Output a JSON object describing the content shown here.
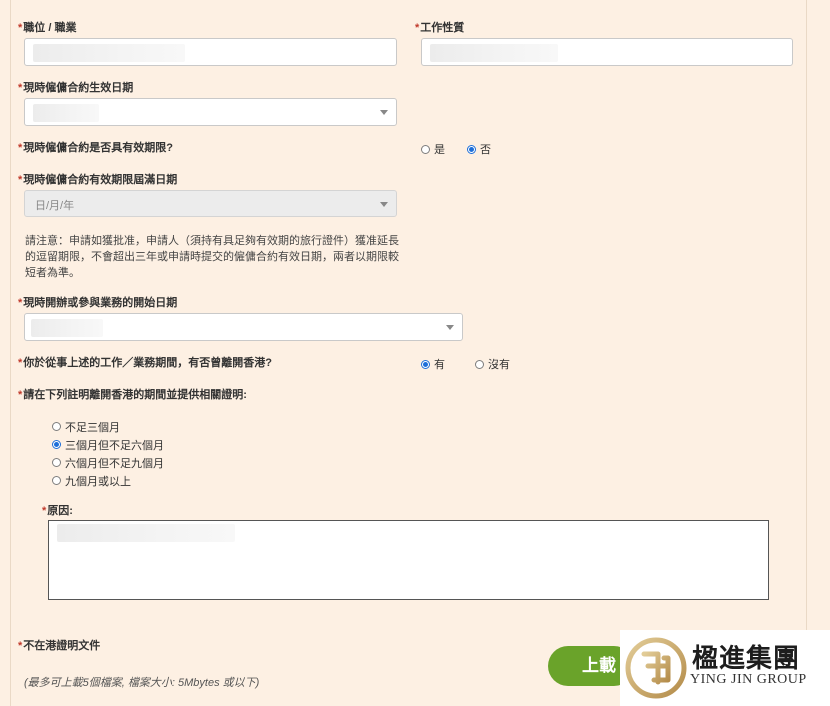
{
  "required_mark": "*",
  "occupation": {
    "label": "職位 / 職業"
  },
  "job_nature": {
    "label": "工作性質"
  },
  "contract_effective_date": {
    "label": "現時僱傭合約生效日期"
  },
  "contract_has_validity": {
    "label": "現時僱傭合約是否具有效期限?",
    "options": [
      "是",
      "否"
    ],
    "selected": "否"
  },
  "contract_expiry_date": {
    "label": "現時僱傭合約有效期限屆滿日期",
    "placeholder": "日/月/年",
    "disabled": true
  },
  "notice_text": "請注意：申請如獲批准，申請人（須持有具足夠有效期的旅行證件）獲准延長的逗留期限，不會超出三年或申請時提交的僱傭合約有效日期，兩者以期限較短者為準。",
  "business_start_date": {
    "label": "現時開辦或參與業務的開始日期"
  },
  "left_hk": {
    "label": "你於從事上述的工作／業務期間，有否曾離開香港?",
    "options": [
      "有",
      "沒有"
    ],
    "selected": "有"
  },
  "absence_period": {
    "label": "請在下列註明離開香港的期間並提供相關證明:",
    "options": [
      "不足三個月",
      "三個月但不足六個月",
      "六個月但不足九個月",
      "九個月或以上"
    ],
    "selected": "三個月但不足六個月"
  },
  "reason": {
    "label": "原因:"
  },
  "absence_proof": {
    "label": "不在港證明文件",
    "hint": "(最多可上載5個檔案, 檔案大小: 5Mbytes 或以下)",
    "upload_label": "上載"
  },
  "watermark": {
    "name_cn": "楹進集團",
    "name_en": "YING JIN GROUP",
    "colors": {
      "gold": "#c9a96a",
      "dark": "#1d1d1d"
    }
  },
  "colors": {
    "background": "#fdf0e3",
    "required": "#c0392b",
    "radio_selected": "#1e6fd9",
    "upload_button": "#6aa32a"
  }
}
